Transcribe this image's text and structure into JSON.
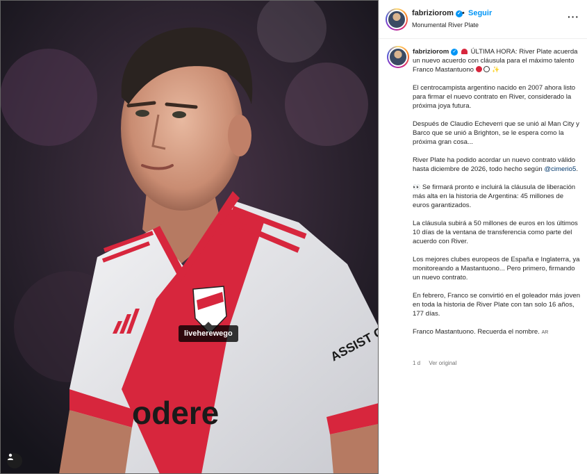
{
  "header": {
    "username": "fabriziorom",
    "separator": "•",
    "follow_label": "Seguir",
    "location": "Monumental River Plate",
    "more_label": "···"
  },
  "media": {
    "tag_username": "liveherewego",
    "sponsor_text": "odere",
    "sleeve_text": "ASSIST CAR",
    "tags_icon": "person-tag-icon"
  },
  "caption": {
    "username": "fabriziorom",
    "first_line": "ÚLTIMA HORA: River Plate acuerda un nuevo acuerdo con cláusula para el máximo talento Franco Mastantuono",
    "p2": "El centrocampista argentino nacido en 2007 ahora listo para firmar el nuevo contrato en River, considerado la próxima joya futura.",
    "p3": "Después de Claudio Echeverri que se unió al Man City y Barco que se unió a Brighton, se le espera como la próxima gran cosa...",
    "p4_text": "River Plate ha podido acordar un nuevo contrato válido hasta diciembre de 2026, todo hecho según",
    "p4_mention": "@cimerio5",
    "p4_end": ".",
    "p5": "Se firmará pronto e incluirá la cláusula de liberación más alta en la historia de Argentina: 45 millones de euros garantizados.",
    "p6": "La cláusula subirá a 50 millones de euros en los últimos 10 días de la ventana de transferencia como parte del acuerdo con River.",
    "p7": "Los mejores clubes europeos de España e Inglaterra, ya monitoreando a Mastantuono... Pero primero, firmando un nuevo contrato.",
    "p8": "En febrero, Franco se convirtió en el goleador más joven en toda la historia de River Plate con tan solo 16 años, 177 días.",
    "p9": "Franco Mastantuono. Recuerda el nombre.",
    "p9_flag": "AR"
  },
  "meta": {
    "time": "1 d",
    "see_original": "Ver original"
  },
  "colors": {
    "accent": "#0095f6",
    "mention": "#00376b",
    "river_red": "#d7263d"
  }
}
